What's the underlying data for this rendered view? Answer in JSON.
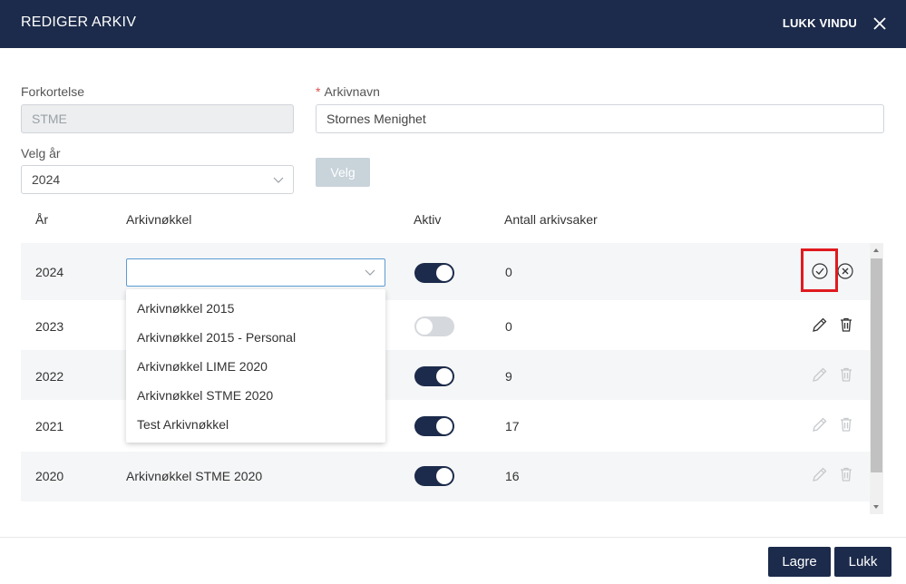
{
  "header": {
    "title": "REDIGER ARKIV",
    "close_label": "LUKK VINDU"
  },
  "form": {
    "abbreviation_label": "Forkortelse",
    "abbreviation_value": "STME",
    "name_required_mark": "*",
    "name_label": "Arkivnavn",
    "name_value": "Stornes Menighet",
    "year_label": "Velg år",
    "year_value": "2024",
    "select_button": "Velg"
  },
  "table": {
    "headers": {
      "year": "År",
      "key": "Arkivnøkkel",
      "active": "Aktiv",
      "count": "Antall arkivsaker"
    },
    "rows": [
      {
        "year": "2024",
        "key": "",
        "active": true,
        "count": "0"
      },
      {
        "year": "2023",
        "key": "",
        "active": false,
        "count": "0"
      },
      {
        "year": "2022",
        "key": "",
        "active": true,
        "count": "9"
      },
      {
        "year": "2021",
        "key": "",
        "active": true,
        "count": "17"
      },
      {
        "year": "2020",
        "key": "Arkivnøkkel STME 2020",
        "active": true,
        "count": "16"
      }
    ]
  },
  "dropdown": {
    "options": [
      "Arkivnøkkel 2015",
      "Arkivnøkkel 2015 - Personal",
      "Arkivnøkkel LIME 2020",
      "Arkivnøkkel STME 2020",
      "Test Arkivnøkkel"
    ]
  },
  "footer": {
    "save_label": "Lagre",
    "close_label": "Lukk"
  },
  "colors": {
    "header_bg": "#1c2b4b",
    "toggle_on": "#1c2b4b",
    "highlight": "#e0191e"
  }
}
